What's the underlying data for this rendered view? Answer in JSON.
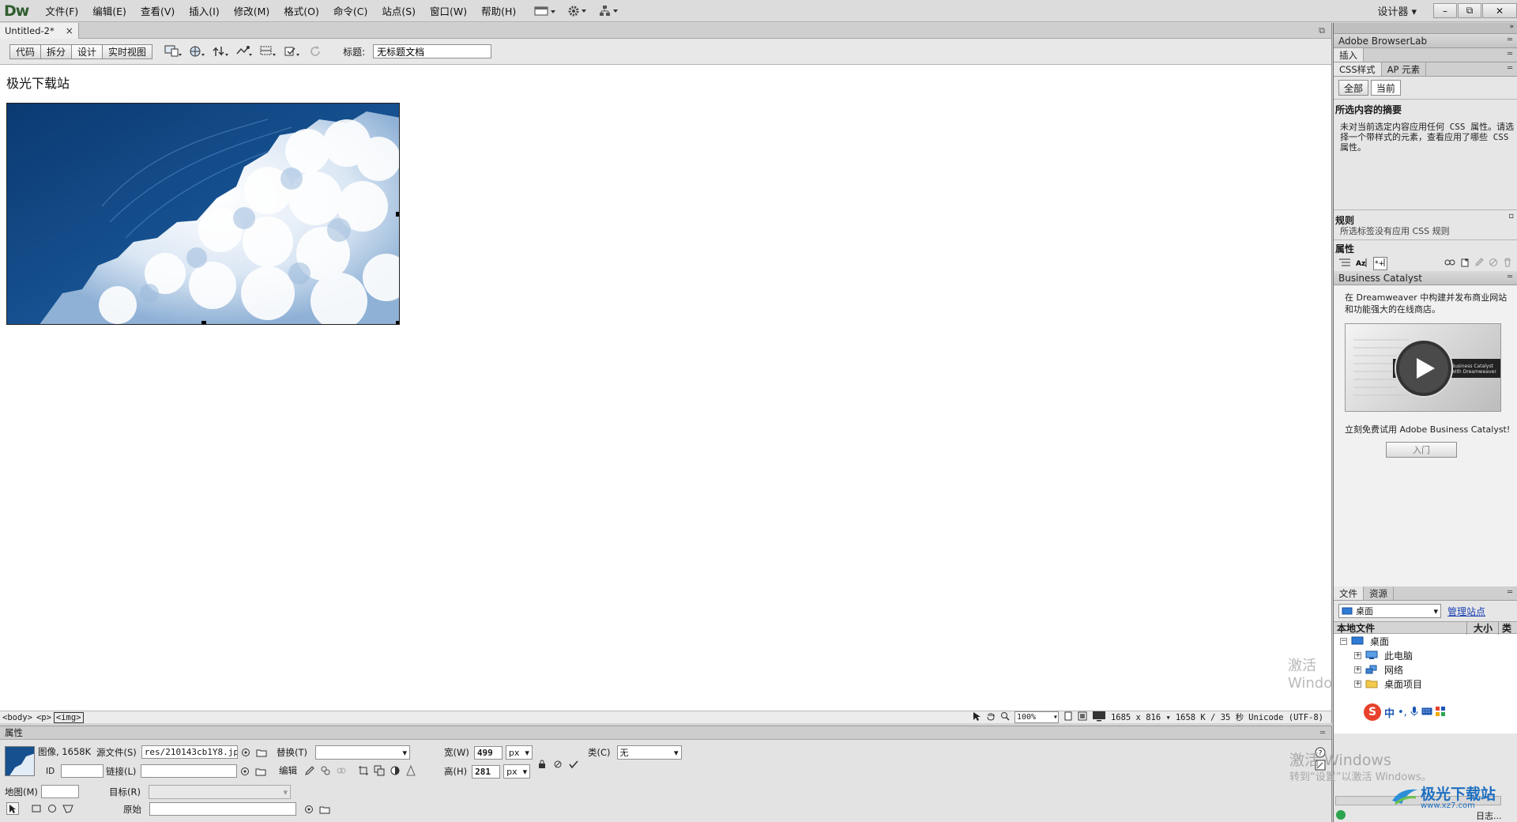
{
  "app": {
    "logo": "Dw",
    "workspace": "设计器",
    "window_buttons": {
      "minimize": "–",
      "restore": "⧉",
      "close": "✕"
    }
  },
  "menu": [
    "文件(F)",
    "编辑(E)",
    "查看(V)",
    "插入(I)",
    "修改(M)",
    "格式(O)",
    "命令(C)",
    "站点(S)",
    "窗口(W)",
    "帮助(H)"
  ],
  "document": {
    "tab_title": "Untitled-2*",
    "tab_close": "×",
    "view_buttons": [
      "代码",
      "拆分",
      "设计",
      "实时视图"
    ],
    "active_view": "设计",
    "title_label": "标题:",
    "title_value": "无标题文档",
    "heading_text": "极光下载站",
    "image_name": "cumulus-cloud-image"
  },
  "tag_status": {
    "tags": [
      "<body>",
      "<p>",
      "<img>"
    ],
    "zoom": "100%",
    "dimensions": "1685 x 816",
    "size": "1658 K / 35 秒",
    "encoding": "Unicode (UTF-8)"
  },
  "property_inspector": {
    "header": "属性",
    "type_label": "图像, 1658K",
    "id_label": "ID",
    "src_label": "源文件(S)",
    "src_value": "res/210143cb1Y8.jpg",
    "link_label": "链接(L)",
    "link_value": "",
    "alt_label": "替换(T)",
    "alt_value": "",
    "edit_label": "编辑",
    "width_label": "宽(W)",
    "width_value": "499",
    "height_label": "高(H)",
    "height_value": "281",
    "unit": "px",
    "class_label": "类(C)",
    "class_value": "无",
    "map_label": "地图(M)",
    "target_label": "目标(R)",
    "original_label": "原始"
  },
  "right_panel": {
    "browserlab": "Adobe BrowserLab",
    "insert": "插入",
    "css_tabs": [
      "CSS样式",
      "AP 元素"
    ],
    "css_buttons": [
      "全部",
      "当前"
    ],
    "summary_title": "所选内容的摘要",
    "summary_text": "未对当前选定内容应用任何 CSS 属性。请选择一个带样式的元素，查看应用了哪些 CSS 属性。",
    "rules_title": "规则",
    "rules_text": "所选标签没有应用 CSS 规则",
    "props_title": "属性",
    "bc_title": "Business Catalyst",
    "bc_desc": "在 Dreamweaver 中构建并发布商业网站和功能强大的在线商店。",
    "bc_video_text": "Business Catalyst with Dreamweaver",
    "bc_trial": "立刻免费试用 Adobe Business Catalyst!",
    "bc_button": "入门",
    "files_tabs": [
      "文件",
      "资源"
    ],
    "location": "桌面",
    "manage_sites": "管理站点",
    "cols": [
      "本地文件",
      "大小",
      "类"
    ],
    "tree": [
      {
        "label": "桌面",
        "level": 0,
        "expander": "−"
      },
      {
        "label": "此电脑",
        "level": 1,
        "expander": "+"
      },
      {
        "label": "网络",
        "level": 1,
        "expander": "+"
      },
      {
        "label": "桌面项目",
        "level": 1,
        "expander": "+"
      }
    ],
    "log_label": "日志..."
  },
  "overlay": {
    "activate_title": "激活 Windows",
    "activate_sub": "转到“设置”以激活 Windows。",
    "watermark": "极光下载站",
    "watermark_url": "www.xz7.com",
    "ime_chars": [
      "中"
    ]
  },
  "colors": {
    "accent_blue": "#1a56b3",
    "link_blue": "#1a3fb3",
    "logo_green": "#2f5d2f"
  }
}
